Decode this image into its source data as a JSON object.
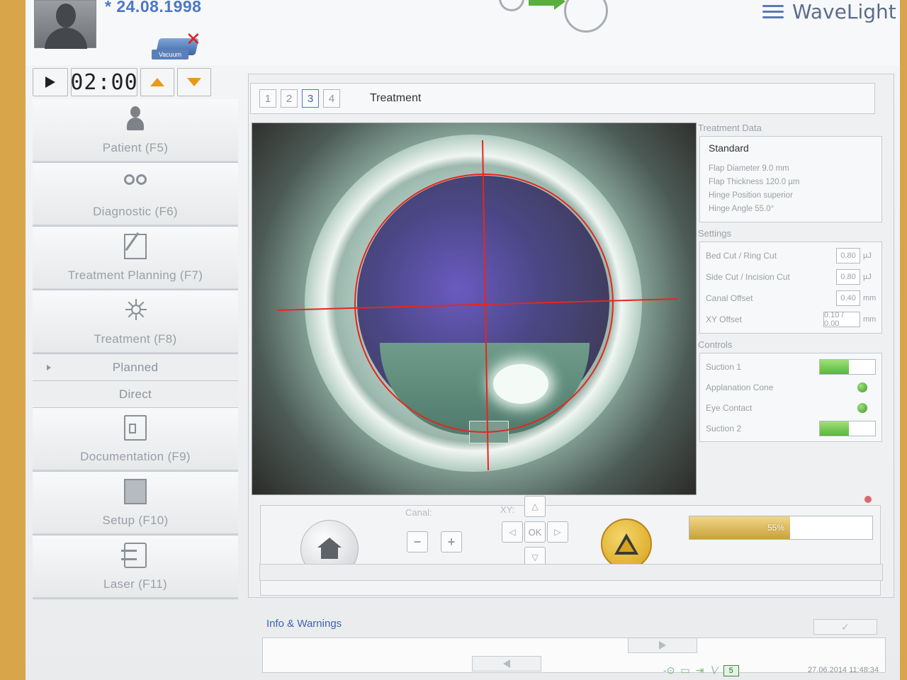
{
  "header": {
    "dob": "* 24.08.1998",
    "vacuum_label": "Vacuum",
    "brand_name": "WaveLight"
  },
  "timer": {
    "display": "02:00"
  },
  "nav": {
    "items": [
      {
        "label": "Patient (F5)",
        "icon": "person-icon"
      },
      {
        "label": "Diagnostic (F6)",
        "icon": "diagnostic-icon"
      },
      {
        "label": "Treatment Planning (F7)",
        "icon": "planning-icon"
      },
      {
        "label": "Treatment (F8)",
        "icon": "laser-burst-icon"
      }
    ],
    "sub_items": [
      {
        "label": "Planned"
      },
      {
        "label": "Direct"
      }
    ],
    "items_after": [
      {
        "label": "Documentation (F9)",
        "icon": "document-icon"
      },
      {
        "label": "Setup (F10)",
        "icon": "setup-icon"
      },
      {
        "label": "Laser (F11)",
        "icon": "laser-icon"
      }
    ]
  },
  "steps": {
    "labels": [
      "1",
      "2",
      "3",
      "4"
    ],
    "active": "3",
    "title": "Treatment"
  },
  "treatment_data": {
    "title": "Treatment Data",
    "profile": "Standard",
    "lines": [
      "Flap Diameter 9.0 mm",
      "Flap Thickness 120.0 µm",
      "Hinge Position superior",
      "Hinge Angle 55.0°"
    ]
  },
  "settings": {
    "title": "Settings",
    "rows": [
      {
        "label": "Bed Cut / Ring Cut",
        "value": "0.80",
        "unit": "µJ"
      },
      {
        "label": "Side Cut / Incision Cut",
        "value": "0.80",
        "unit": "µJ"
      },
      {
        "label": "Canal Offset",
        "value": "0.40",
        "unit": "mm"
      },
      {
        "label": "XY Offset",
        "value": "0.10 / 0.00",
        "unit": "mm"
      }
    ]
  },
  "controls": {
    "title": "Controls",
    "rows": [
      {
        "label": "Suction 1",
        "type": "bar",
        "level": 0.52,
        "color": "#5ab73a"
      },
      {
        "label": "Applanation Cone",
        "type": "led",
        "color": "#3f9a2a"
      },
      {
        "label": "Eye Contact",
        "type": "led",
        "color": "#3f9a2a"
      },
      {
        "label": "Suction 2",
        "type": "bar",
        "level": 0.52,
        "color": "#5ab73a"
      }
    ]
  },
  "bottom_controls": {
    "canal_label": "Canal:",
    "minus": "−",
    "plus": "+",
    "xy_label": "XY:",
    "ok": "OK",
    "progress_text": "55%",
    "progress_value": 0.55
  },
  "info": {
    "title": "Info & Warnings",
    "ack": "✓",
    "counter": "5",
    "datetime": "27.06.2014 11:48:34"
  },
  "colors": {
    "accent_blue": "#4c78c6",
    "ok_green": "#5ab73a",
    "warning_amber": "#d6a218",
    "crosshair_red": "#e8261c"
  }
}
